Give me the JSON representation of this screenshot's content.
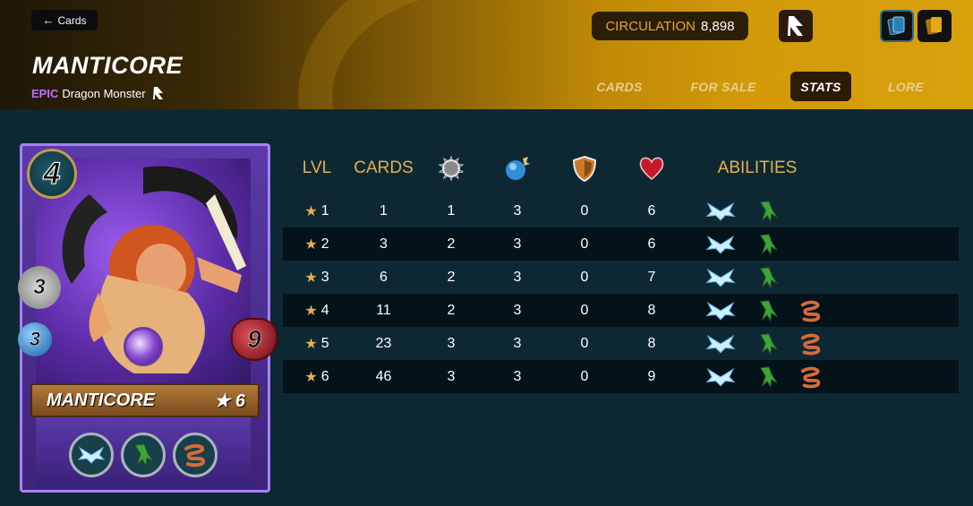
{
  "header": {
    "back_label": "Cards",
    "title": "MANTICORE",
    "rarity": "EPIC",
    "type": "Dragon Monster",
    "circulation_label": "CIRCULATION",
    "circulation_value": "8,898"
  },
  "tabs": [
    {
      "label": "CARDS",
      "active": false
    },
    {
      "label": "FOR SALE",
      "active": false
    },
    {
      "label": "STATS",
      "active": true
    },
    {
      "label": "LORE",
      "active": false
    }
  ],
  "card": {
    "mana": "4",
    "attack": "3",
    "speed": "3",
    "health": "9",
    "name": "MANTICORE",
    "level": "★ 6",
    "abilities": [
      "shield-wings-icon",
      "green-claw-icon",
      "coil-icon"
    ]
  },
  "table": {
    "headers": {
      "lvl": "LVL",
      "cards": "CARDS",
      "attack": "attack-icon",
      "speed": "speed-icon",
      "armor": "armor-icon",
      "health": "health-icon",
      "abilities": "ABILITIES"
    },
    "rows": [
      {
        "lvl": "1",
        "cards": "1",
        "attack": "1",
        "speed": "3",
        "armor": "0",
        "health": "6",
        "abilities": [
          "shield-wings-icon",
          "green-claw-icon"
        ]
      },
      {
        "lvl": "2",
        "cards": "3",
        "attack": "2",
        "speed": "3",
        "armor": "0",
        "health": "6",
        "abilities": [
          "shield-wings-icon",
          "green-claw-icon"
        ]
      },
      {
        "lvl": "3",
        "cards": "6",
        "attack": "2",
        "speed": "3",
        "armor": "0",
        "health": "7",
        "abilities": [
          "shield-wings-icon",
          "green-claw-icon"
        ]
      },
      {
        "lvl": "4",
        "cards": "11",
        "attack": "2",
        "speed": "3",
        "armor": "0",
        "health": "8",
        "abilities": [
          "shield-wings-icon",
          "green-claw-icon",
          "coil-icon"
        ]
      },
      {
        "lvl": "5",
        "cards": "23",
        "attack": "3",
        "speed": "3",
        "armor": "0",
        "health": "8",
        "abilities": [
          "shield-wings-icon",
          "green-claw-icon",
          "coil-icon"
        ]
      },
      {
        "lvl": "6",
        "cards": "46",
        "attack": "3",
        "speed": "3",
        "armor": "0",
        "health": "9",
        "abilities": [
          "shield-wings-icon",
          "green-claw-icon",
          "coil-icon"
        ]
      }
    ]
  },
  "colors": {
    "background": "#0e2833",
    "header_gold": "#d49a09",
    "accent_gold": "#e3b04f",
    "epic_purple": "#c46dff",
    "row_alt": "#041219"
  }
}
